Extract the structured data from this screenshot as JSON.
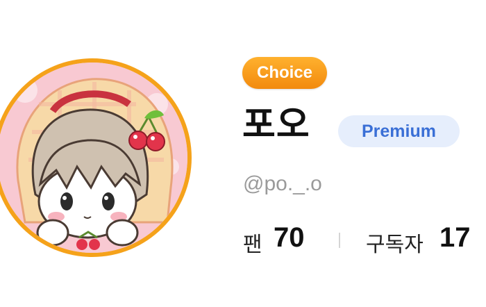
{
  "profile": {
    "choice_badge": "Choice",
    "display_name": "포오",
    "premium_badge": "Premium",
    "handle": "@po._.o"
  },
  "stats": {
    "fans_label": "팬",
    "fans_value": "70",
    "subscribers_label": "구독자",
    "subscribers_value": "17"
  },
  "colors": {
    "avatar_ring": "#f5a21a",
    "choice_badge": "#f59a1a",
    "premium_badge_bg": "#e6eefc",
    "premium_badge_text": "#3a6fd6",
    "handle_text": "#9a9a9a"
  },
  "icons": {
    "avatar": "anime-girl-with-cherry-hood-avatar"
  }
}
